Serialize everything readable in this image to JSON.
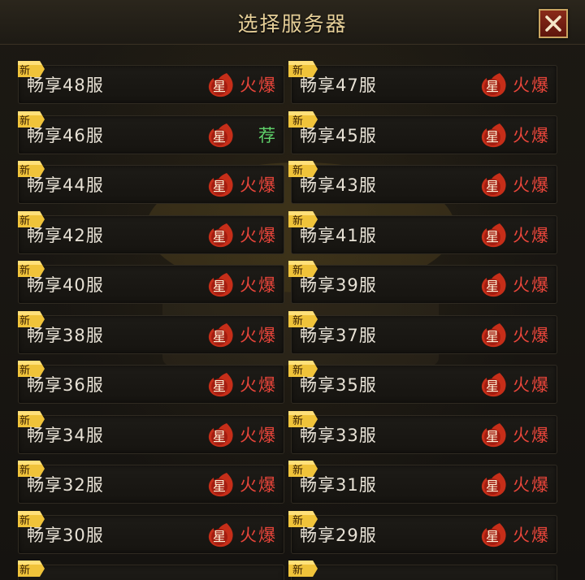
{
  "dialog": {
    "title": "选择服务器"
  },
  "theme": {
    "hot_color": "#e9453a",
    "recommend_color": "#5fd26a",
    "badge_color": "#f0c33a",
    "flame_color": "#d1361f"
  },
  "icons": {
    "close": "close-x-icon",
    "star": "flame-star-icon",
    "new": "new-ribbon-icon"
  },
  "servers": [
    {
      "name": "畅享48服",
      "new_label": "新",
      "star_label": "星",
      "status": "火爆",
      "status_type": "hot"
    },
    {
      "name": "畅享47服",
      "new_label": "新",
      "star_label": "星",
      "status": "火爆",
      "status_type": "hot"
    },
    {
      "name": "畅享46服",
      "new_label": "新",
      "star_label": "星",
      "status": "荐",
      "status_type": "recommend"
    },
    {
      "name": "畅享45服",
      "new_label": "新",
      "star_label": "星",
      "status": "火爆",
      "status_type": "hot"
    },
    {
      "name": "畅享44服",
      "new_label": "新",
      "star_label": "星",
      "status": "火爆",
      "status_type": "hot"
    },
    {
      "name": "畅享43服",
      "new_label": "新",
      "star_label": "星",
      "status": "火爆",
      "status_type": "hot"
    },
    {
      "name": "畅享42服",
      "new_label": "新",
      "star_label": "星",
      "status": "火爆",
      "status_type": "hot"
    },
    {
      "name": "畅享41服",
      "new_label": "新",
      "star_label": "星",
      "status": "火爆",
      "status_type": "hot"
    },
    {
      "name": "畅享40服",
      "new_label": "新",
      "star_label": "星",
      "status": "火爆",
      "status_type": "hot"
    },
    {
      "name": "畅享39服",
      "new_label": "新",
      "star_label": "星",
      "status": "火爆",
      "status_type": "hot"
    },
    {
      "name": "畅享38服",
      "new_label": "新",
      "star_label": "星",
      "status": "火爆",
      "status_type": "hot"
    },
    {
      "name": "畅享37服",
      "new_label": "新",
      "star_label": "星",
      "status": "火爆",
      "status_type": "hot"
    },
    {
      "name": "畅享36服",
      "new_label": "新",
      "star_label": "星",
      "status": "火爆",
      "status_type": "hot"
    },
    {
      "name": "畅享35服",
      "new_label": "新",
      "star_label": "星",
      "status": "火爆",
      "status_type": "hot"
    },
    {
      "name": "畅享34服",
      "new_label": "新",
      "star_label": "星",
      "status": "火爆",
      "status_type": "hot"
    },
    {
      "name": "畅享33服",
      "new_label": "新",
      "star_label": "星",
      "status": "火爆",
      "status_type": "hot"
    },
    {
      "name": "畅享32服",
      "new_label": "新",
      "star_label": "星",
      "status": "火爆",
      "status_type": "hot"
    },
    {
      "name": "畅享31服",
      "new_label": "新",
      "star_label": "星",
      "status": "火爆",
      "status_type": "hot"
    },
    {
      "name": "畅享30服",
      "new_label": "新",
      "star_label": "星",
      "status": "火爆",
      "status_type": "hot"
    },
    {
      "name": "畅享29服",
      "new_label": "新",
      "star_label": "星",
      "status": "火爆",
      "status_type": "hot"
    },
    {
      "name": "",
      "new_label": "新",
      "star_label": "",
      "status": "",
      "status_type": "hot"
    },
    {
      "name": "",
      "new_label": "新",
      "star_label": "",
      "status": "",
      "status_type": "hot"
    }
  ]
}
